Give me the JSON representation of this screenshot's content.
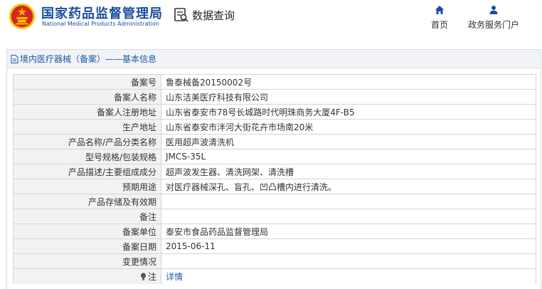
{
  "header": {
    "brand_cn": "国家药品监督管理局",
    "brand_en": "National Medical Products Administration",
    "search_label": "数据查询",
    "nav": [
      {
        "label": "首页",
        "icon": "home-icon"
      },
      {
        "label": "政务服务门户",
        "icon": "user-icon"
      }
    ]
  },
  "panel": {
    "title": "境内医疗器械（备案）——基本信息"
  },
  "rows": [
    {
      "label": "备案号",
      "value": "鲁泰械备20150002号"
    },
    {
      "label": "备案人名称",
      "value": "山东洁美医疗科技有限公司"
    },
    {
      "label": "备案人注册地址",
      "value": "山东省泰安市78号长城路时代明珠商务大厦4F-B5"
    },
    {
      "label": "生产地址",
      "value": "山东省泰安市泮河大街花卉市场南20米"
    },
    {
      "label": "产品名称/产品分类名称",
      "value": "医用超声波清洗机"
    },
    {
      "label": "型号规格/包装规格",
      "value": "JMCS-35L"
    },
    {
      "label": "产品描述/主要组成成分",
      "value": "超声波发生器、清洗网架、清洗槽"
    },
    {
      "label": "预期用途",
      "value": "对医疗器械深孔、盲孔、凹凸槽内进行清洗。"
    },
    {
      "label": "产品存储及有效期",
      "value": ""
    },
    {
      "label": "备注",
      "value": ""
    },
    {
      "label": "备案单位",
      "value": "泰安市食品药品监督管理局"
    },
    {
      "label": "备案日期",
      "value": "2015-06-11"
    },
    {
      "label": "变更情况",
      "value": ""
    }
  ],
  "note_row": {
    "label": "注",
    "link": "详情",
    "icon": "lightbulb-icon"
  },
  "colors": {
    "brand_blue": "#1a4fa0",
    "link_blue": "#1a58a8",
    "emblem_red": "#d7261e",
    "emblem_gold": "#f5c400"
  }
}
